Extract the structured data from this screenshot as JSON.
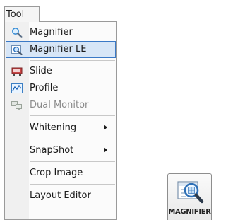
{
  "menubar": {
    "label": "Tool"
  },
  "menu": {
    "items": [
      {
        "label": "Magnifier",
        "icon": "magnifier-icon"
      },
      {
        "label": "Magnifier LE",
        "icon": "magnifier-le-icon",
        "state": "highlighted"
      },
      {
        "label": "Slide",
        "icon": "slide-icon"
      },
      {
        "label": "Profile",
        "icon": "profile-icon"
      },
      {
        "label": "Dual Monitor",
        "icon": "dual-monitor-icon",
        "state": "disabled"
      },
      {
        "label": "Whitening",
        "submenu": true
      },
      {
        "label": "SnapShot",
        "submenu": true
      },
      {
        "label": "Crop Image"
      },
      {
        "label": "Layout Editor"
      }
    ]
  },
  "ribbon_button": {
    "label": "MAGNIFIER",
    "icon": "magnifier-large-icon"
  },
  "colors": {
    "highlight_fill": "#d7e6f7",
    "highlight_border": "#3a79c6",
    "disabled_text": "#8a8a8a"
  }
}
